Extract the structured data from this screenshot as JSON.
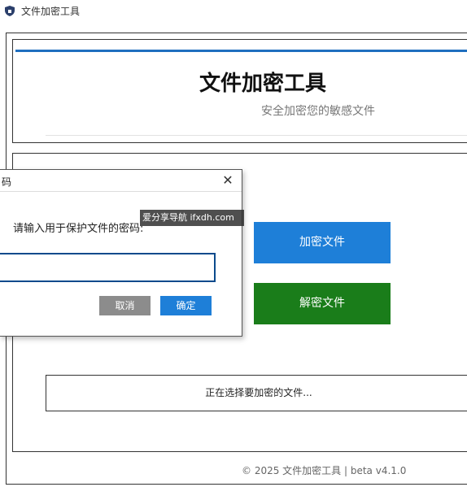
{
  "window": {
    "title": "文件加密工具"
  },
  "header": {
    "title": "文件加密工具",
    "subtitle": "安全加密您的敏感文件",
    "accent_color": "#1f6fbf"
  },
  "main": {
    "encrypt_label": "加密文件",
    "decrypt_label": "解密文件",
    "status_text": "正在选择要加密的文件...",
    "encrypt_color": "#1e7fd8",
    "decrypt_color": "#1a7d1a"
  },
  "footer": {
    "text": "© 2025 文件加密工具 | beta v4.1.0"
  },
  "dialog": {
    "title": "码",
    "prompt": "请输入用于保护文件的密码:",
    "password_value": "",
    "cancel_label": "取消",
    "ok_label": "确定",
    "close_icon": "close-icon"
  },
  "watermark": {
    "text": "爱分享导航 ifxdh.com"
  }
}
